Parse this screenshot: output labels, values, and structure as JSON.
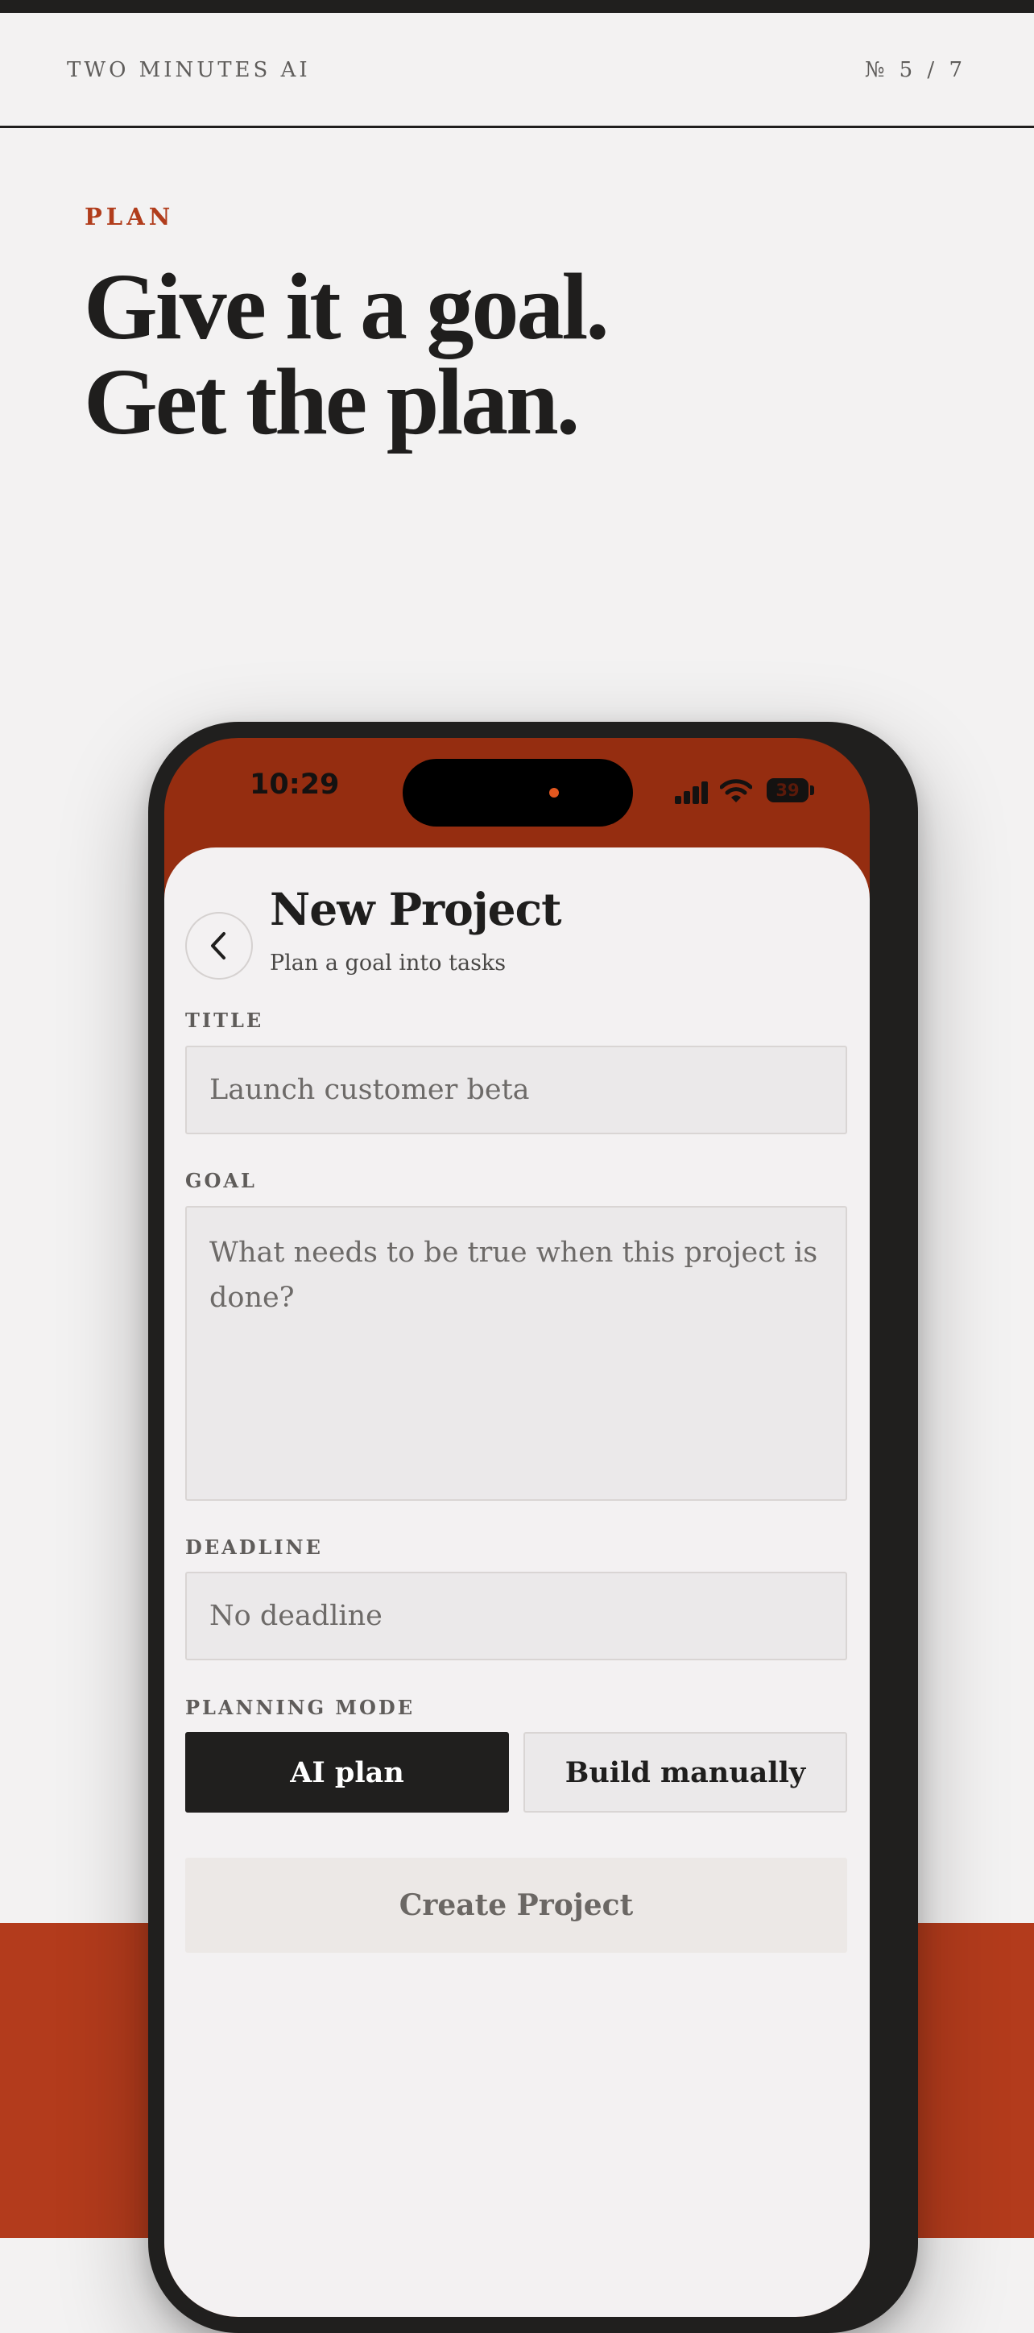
{
  "header": {
    "brand": "TWO MINUTES AI",
    "page_indicator": "№ 5 / 7"
  },
  "hero": {
    "eyebrow": "PLAN",
    "headline_line1": "Give it a goal.",
    "headline_line2": "Get the plan."
  },
  "status_bar": {
    "time": "10:29",
    "battery": "39"
  },
  "screen": {
    "title": "New Project",
    "subtitle": "Plan a goal into tasks",
    "back_icon": "chevron-left-icon"
  },
  "form": {
    "title_label": "TITLE",
    "title_placeholder": "Launch customer beta",
    "goal_label": "GOAL",
    "goal_placeholder": "What needs to be true when this project is done?",
    "deadline_label": "DEADLINE",
    "deadline_placeholder": "No deadline",
    "mode_label": "PLANNING MODE",
    "mode_options": [
      "AI plan",
      "Build manually"
    ],
    "mode_selected": "AI plan",
    "submit_label": "Create Project"
  },
  "colors": {
    "accent": "#b33b1c",
    "status_bar_bg": "#952d10",
    "ink": "#1f1e1d",
    "page_bg": "#f3f2f2"
  }
}
